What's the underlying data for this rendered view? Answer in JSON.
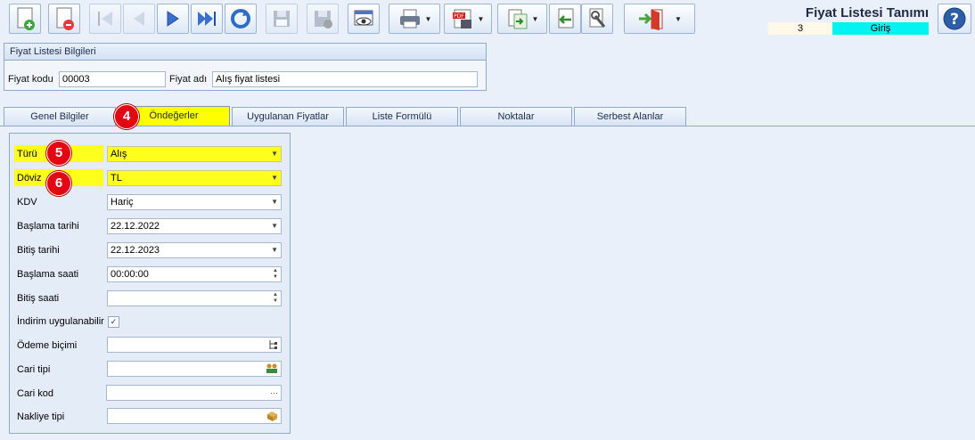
{
  "toolbar": {
    "buttons": [
      {
        "name": "new-record-button",
        "icon": "add-document-icon"
      },
      {
        "name": "delete-record-button",
        "icon": "delete-document-icon"
      },
      {
        "name": "first-record-button",
        "icon": "first-icon"
      },
      {
        "name": "previous-record-button",
        "icon": "previous-icon"
      },
      {
        "name": "next-record-button",
        "icon": "next-icon"
      },
      {
        "name": "last-record-button",
        "icon": "last-icon"
      },
      {
        "name": "refresh-button",
        "icon": "refresh-icon"
      },
      {
        "name": "save-button",
        "icon": "save-icon"
      },
      {
        "name": "cancel-save-button",
        "icon": "save-cancel-icon"
      },
      {
        "name": "preview-button",
        "icon": "preview-icon"
      },
      {
        "name": "print-button",
        "icon": "printer-icon"
      },
      {
        "name": "pdf-export-button",
        "icon": "pdf-icon"
      },
      {
        "name": "export-button",
        "icon": "export-icon"
      },
      {
        "name": "import-button",
        "icon": "import-icon"
      },
      {
        "name": "tools-button",
        "icon": "tools-icon"
      },
      {
        "name": "exit-button",
        "icon": "exit-door-icon"
      }
    ]
  },
  "header": {
    "title": "Fiyat Listesi Tanımı",
    "record_number": "3",
    "mode": "Giriş",
    "mode_color": "#00f2f2"
  },
  "info_group": {
    "title": "Fiyat Listesi Bilgileri",
    "code_label": "Fiyat kodu",
    "code_value": "00003",
    "name_label": "Fiyat adı",
    "name_value": "Alış fiyat listesi"
  },
  "tabs": [
    {
      "label": "Genel Bilgiler"
    },
    {
      "label": "Öndeğerler",
      "active": true,
      "badge": "4"
    },
    {
      "label": "Uygulanan Fiyatlar"
    },
    {
      "label": "Liste Formülü"
    },
    {
      "label": "Noktalar"
    },
    {
      "label": "Serbest Alanlar"
    }
  ],
  "form": {
    "fields": [
      {
        "label": "Türü",
        "value": "Alış",
        "kind": "dropdown",
        "highlight": true,
        "badge": "5"
      },
      {
        "label": "Döviz",
        "value": "TL",
        "kind": "dropdown",
        "highlight": true,
        "badge": "6"
      },
      {
        "label": "KDV",
        "value": "Hariç",
        "kind": "dropdown"
      },
      {
        "label": "Başlama tarihi",
        "value": "22.12.2022",
        "kind": "dropdown"
      },
      {
        "label": "Bitiş tarihi",
        "value": "22.12.2023",
        "kind": "dropdown"
      },
      {
        "label": "Başlama saati",
        "value": "00:00:00",
        "kind": "spinner"
      },
      {
        "label": "Bitiş saati",
        "value": "",
        "kind": "spinner"
      },
      {
        "label": "İndirim uygulanabilir",
        "value": "✓",
        "kind": "checkbox"
      },
      {
        "label": "Ödeme biçimi",
        "value": "",
        "kind": "tree"
      },
      {
        "label": "Cari tipi",
        "value": "",
        "kind": "people"
      },
      {
        "label": "Cari kod",
        "value": "",
        "kind": "ellipsis",
        "ellipsis": "···"
      },
      {
        "label": "Nakliye tipi",
        "value": "",
        "kind": "box"
      }
    ]
  },
  "colors": {
    "highlight": "#ffff1e",
    "badge": "#e30613"
  }
}
